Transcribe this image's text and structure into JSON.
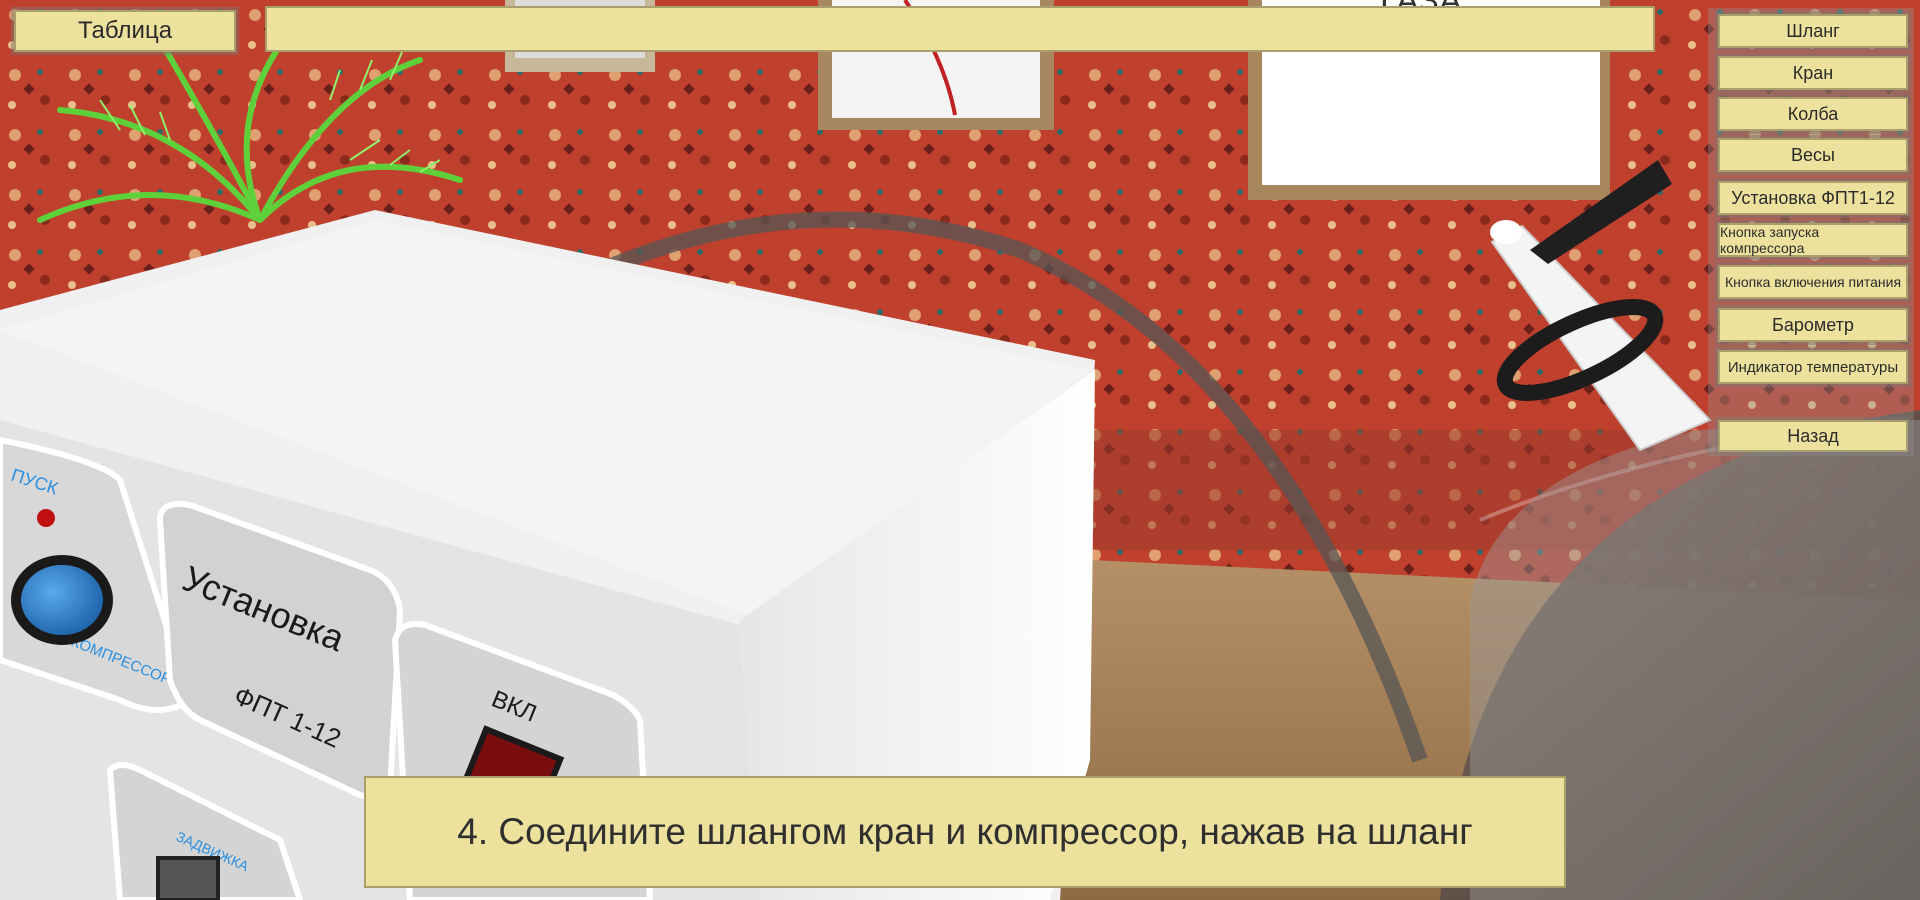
{
  "header": {
    "table_button": "Таблица",
    "status_bar": ""
  },
  "sidebar": {
    "items": [
      {
        "label": "Шланг"
      },
      {
        "label": "Кран"
      },
      {
        "label": "Колба"
      },
      {
        "label": "Весы"
      },
      {
        "label": "Установка ФПТ1-12"
      },
      {
        "label": "Кнопка запуска компрессора"
      },
      {
        "label": "Кнопка включения питания"
      },
      {
        "label": "Барометр"
      },
      {
        "label": "Индикатор температуры"
      }
    ],
    "back_button": "Назад"
  },
  "scene": {
    "device_title": "Установка",
    "device_model": "ФПТ 1-12",
    "start_label": "ПУСК",
    "compressor_label": "КОМПРЕССОР",
    "power_label": "ВКЛ",
    "damper_label": "ЗАДВИЖКА",
    "poster_text": "ГАЗА"
  },
  "instruction": {
    "text": "4. Соедините шлангом кран и компрессор, нажав на шланг"
  },
  "colors": {
    "panel": "#ece19d",
    "panel_border": "#a89f6a",
    "carpet": "#c0402e",
    "device": "#f2f2f2",
    "button_blue": "#2a7fd0",
    "label_blue": "#2a8fe0"
  }
}
